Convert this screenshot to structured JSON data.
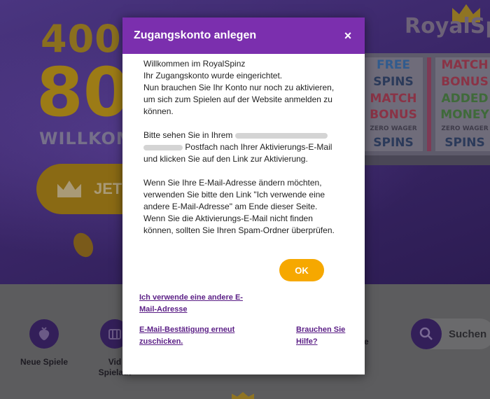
{
  "background": {
    "promo_top": "400",
    "promo_big": "80",
    "promo_welcome": "WILLKOMM",
    "promo_button": "JETZ",
    "logo": "RoyalSp",
    "reels": {
      "left": [
        "FREE",
        "SPINS",
        "MATCH",
        "BONUS",
        "ZERO WAGER",
        "SPINS"
      ],
      "right": [
        "MATCH",
        "BONUS",
        "ADDED",
        "MONEY",
        "ZERO WAGER",
        "SPINS"
      ]
    },
    "categories": [
      {
        "label": "Neue Spiele"
      },
      {
        "label": "Vid\nSpielaut"
      }
    ],
    "partial_label": "e",
    "search_label": "Suchen"
  },
  "modal": {
    "title": "Zugangskonto anlegen",
    "close_symbol": "×",
    "p1_l1": "Willkommen im RoyalSpinz",
    "p1_l2": "Ihr Zugangskonto wurde eingerichtet.",
    "p1_l3": "Nun brauchen Sie Ihr Konto nur noch zu aktivieren,",
    "p1_l4": "um sich zum Spielen auf der Website anmelden zu",
    "p1_l5": "können.",
    "p2_l1": "Bitte sehen Sie in Ihrem",
    "p2_l2": "Postfach nach Ihrer Aktivierungs-E-Mail",
    "p2_l3": "und klicken Sie auf den Link zur Aktivierung.",
    "p3_l1": "Wenn Sie Ihre E-Mail-Adresse ändern möchten,",
    "p3_l2": "verwenden Sie bitte den Link \"Ich verwende eine",
    "p3_l3": "andere E-Mail-Adresse\" am Ende dieser Seite.",
    "p3_l4": "Wenn Sie die Aktivierungs-E-Mail nicht finden",
    "p3_l5": "können, sollten Sie Ihren Spam-Ordner überprüfen.",
    "ok_label": "OK",
    "link_other_email": "Ich verwende eine andere E-Mail-Adresse",
    "link_resend": "E-Mail-Bestätigung erneut zuschicken.",
    "link_help": "Brauchen Sie Hilfe?"
  },
  "colors": {
    "header": "#7b2fae",
    "ok_button": "#f6a800",
    "link": "#5b1f86"
  }
}
